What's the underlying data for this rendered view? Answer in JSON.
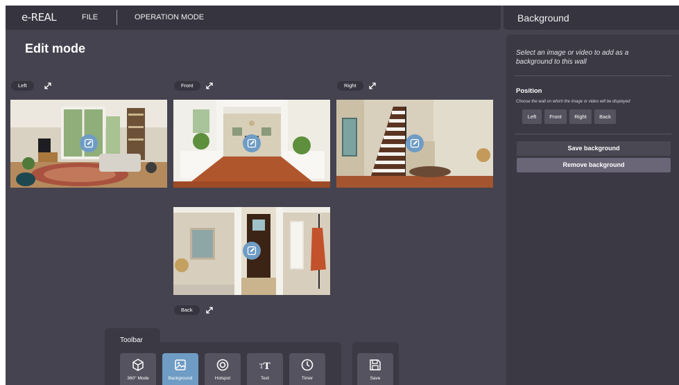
{
  "topbar": {
    "logo": "e-REAL",
    "menu": {
      "file": "FILE",
      "operation_mode": "OPERATION MODE"
    }
  },
  "page": {
    "title": "Edit mode"
  },
  "walls": [
    {
      "key": "left",
      "label": "Left"
    },
    {
      "key": "front",
      "label": "Front"
    },
    {
      "key": "right",
      "label": "Right"
    },
    {
      "key": "back",
      "label": "Back"
    }
  ],
  "sidebar": {
    "title": "Background",
    "description": "Select an image or video to add as a background to this wall",
    "position_title": "Position",
    "position_description": "Choose the wall on which the image or video will be displayed",
    "positions": [
      "Left",
      "Front",
      "Right",
      "Back"
    ],
    "save_label": "Save background",
    "remove_label": "Remove background",
    "colors": {
      "panel": "#3a3944",
      "save_button": "#4a4853",
      "remove_button": "#6a6577"
    }
  },
  "toolbar": {
    "title": "Toolbar",
    "tools": [
      {
        "label": "360° Mode",
        "icon": "cube-icon",
        "active": false
      },
      {
        "label": "Background",
        "icon": "image-icon",
        "active": true
      },
      {
        "label": "Hotspot",
        "icon": "hotspot-icon",
        "active": false
      },
      {
        "label": "Text",
        "icon": "text-icon",
        "active": false
      },
      {
        "label": "Timer",
        "icon": "clock-icon",
        "active": false
      }
    ],
    "save_label": "Save",
    "colors": {
      "active": "#6f9cc4",
      "inactive": "#55535f"
    }
  }
}
